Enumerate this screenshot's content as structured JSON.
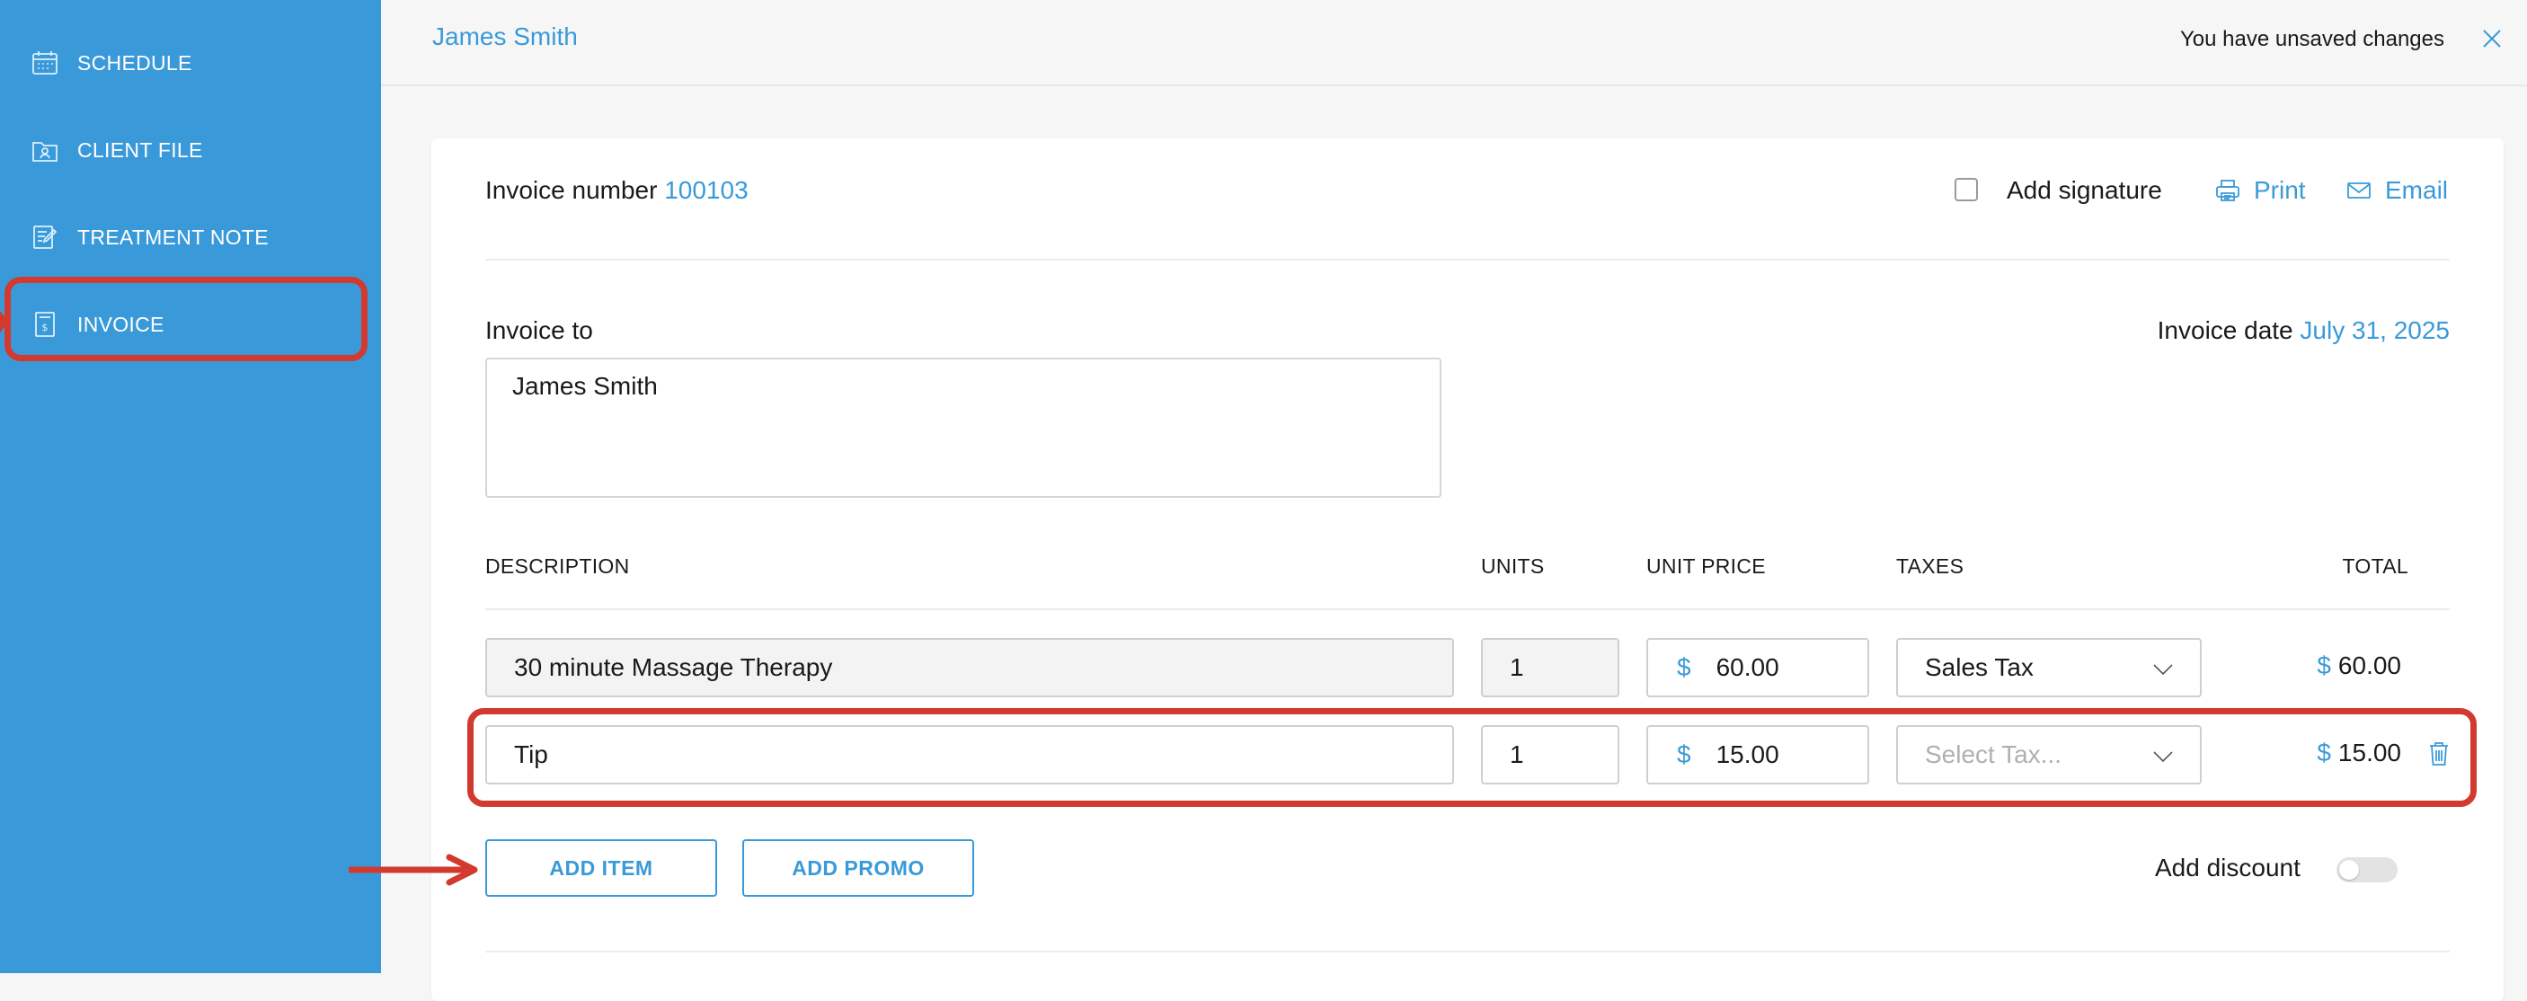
{
  "sidebar": {
    "items": [
      {
        "label": "SCHEDULE",
        "icon": "calendar-icon"
      },
      {
        "label": "CLIENT FILE",
        "icon": "client-file-icon"
      },
      {
        "label": "TREATMENT NOTE",
        "icon": "treatment-note-icon"
      },
      {
        "label": "INVOICE",
        "icon": "invoice-icon",
        "active": true
      }
    ]
  },
  "header": {
    "client_name": "James Smith",
    "status": "You have unsaved changes"
  },
  "invoice": {
    "number_label": "Invoice number",
    "number_value": "100103",
    "add_signature_label": "Add signature",
    "print_label": "Print",
    "email_label": "Email",
    "invoice_to_label": "Invoice to",
    "invoice_to_value": "James Smith",
    "date_label": "Invoice date",
    "date_value": "July 31, 2025",
    "columns": {
      "description": "DESCRIPTION",
      "units": "UNITS",
      "unit_price": "UNIT PRICE",
      "taxes": "TAXES",
      "total": "TOTAL"
    },
    "currency_symbol": "$",
    "items": [
      {
        "description": "30 minute Massage Therapy",
        "units": "1",
        "unit_price": "60.00",
        "tax": "Sales Tax",
        "total": "60.00"
      },
      {
        "description": "Tip",
        "units": "1",
        "unit_price": "15.00",
        "tax": "",
        "tax_placeholder": "Select Tax...",
        "total": "15.00"
      }
    ],
    "add_item_label": "ADD ITEM",
    "add_promo_label": "ADD PROMO",
    "add_discount_label": "Add discount",
    "add_discount_enabled": false
  },
  "colors": {
    "accent": "#3a9ad9",
    "sidebar_bg": "#3a9ad9",
    "highlight": "#d23a30"
  }
}
